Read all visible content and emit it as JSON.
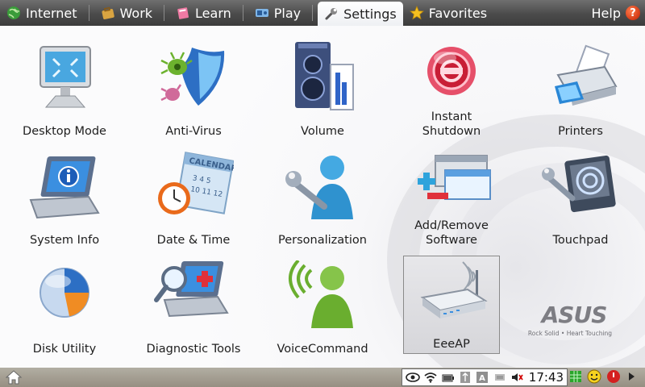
{
  "tabs": [
    {
      "label": "Internet",
      "icon": "globe-icon"
    },
    {
      "label": "Work",
      "icon": "briefcase-icon"
    },
    {
      "label": "Learn",
      "icon": "book-icon"
    },
    {
      "label": "Play",
      "icon": "game-icon"
    },
    {
      "label": "Settings",
      "icon": "wrench-icon",
      "active": true
    },
    {
      "label": "Favorites",
      "icon": "star-icon"
    }
  ],
  "help": {
    "label": "Help",
    "icon": "help-icon"
  },
  "items": [
    {
      "label": "Desktop Mode",
      "icon": "desktop-mode-icon"
    },
    {
      "label": "Anti-Virus",
      "icon": "shield-icon"
    },
    {
      "label": "Volume",
      "icon": "speaker-icon"
    },
    {
      "label": "Instant Shutdown",
      "icon": "shutdown-icon"
    },
    {
      "label": "Printers",
      "icon": "printer-icon"
    },
    {
      "label": "System Info",
      "icon": "laptop-info-icon"
    },
    {
      "label": "Date & Time",
      "icon": "calendar-clock-icon"
    },
    {
      "label": "Personalization",
      "icon": "person-wrench-icon"
    },
    {
      "label": "Add/Remove Software",
      "icon": "add-remove-icon"
    },
    {
      "label": "Touchpad",
      "icon": "touchpad-icon"
    },
    {
      "label": "Disk Utility",
      "icon": "pie-chart-icon"
    },
    {
      "label": "Diagnostic Tools",
      "icon": "diagnostic-icon"
    },
    {
      "label": "VoiceCommand",
      "icon": "voice-icon"
    },
    {
      "label": "EeeAP",
      "icon": "router-icon",
      "selected": true
    }
  ],
  "logo": {
    "brand": "ASUS",
    "tagline": "Rock Solid • Heart Touching"
  },
  "taskbar": {
    "clock": "17:43"
  },
  "colors": {
    "accent_red": "#c8102e",
    "tab_bar": "#4b4b4b",
    "taskbar": "#a39d91"
  }
}
